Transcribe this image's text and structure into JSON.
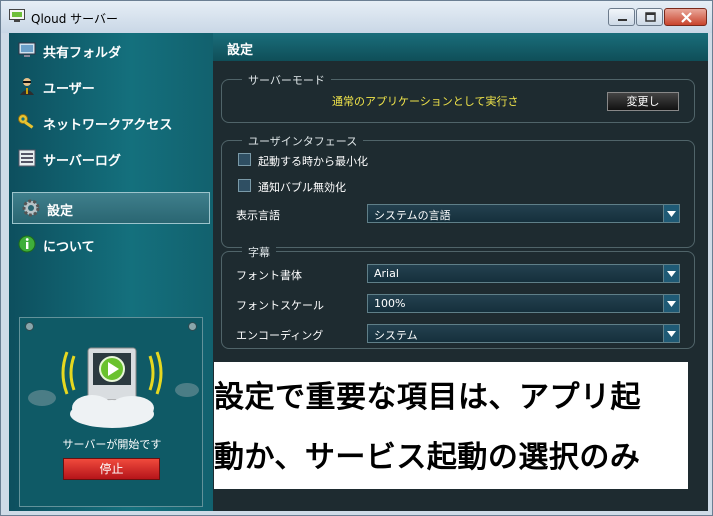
{
  "window": {
    "title": "Qloud サーバー"
  },
  "sidebar": {
    "items": [
      {
        "label": "共有フォルダ",
        "icon": "monitor-icon"
      },
      {
        "label": "ユーザー",
        "icon": "user-icon"
      },
      {
        "label": "ネットワークアクセス",
        "icon": "key-icon"
      },
      {
        "label": "サーバーログ",
        "icon": "log-icon"
      },
      {
        "label": "設定",
        "icon": "gear-icon",
        "active": true
      },
      {
        "label": "について",
        "icon": "info-icon"
      }
    ],
    "server": {
      "status": "サーバーが開始です",
      "stop_label": "停止"
    }
  },
  "main": {
    "title": "設定",
    "server_mode": {
      "title": "サーバーモード",
      "mode_text": "通常のアプリケーションとして実行さ",
      "change_label": "変更し"
    },
    "ui": {
      "title": "ユーザインタフェース",
      "minimize_label": "起動する時から最小化",
      "minimize_checked": false,
      "notify_label": "通知バブル無効化",
      "notify_checked": false,
      "language_label": "表示言語",
      "language_value": "システムの言語"
    },
    "subtitles": {
      "title": "字幕",
      "font_label": "フォント書体",
      "font_value": "Arial",
      "scale_label": "フォントスケール",
      "scale_value": "100%",
      "encoding_label": "エンコーディング",
      "encoding_value": "システム"
    }
  },
  "annotation": {
    "line1": "設定で重要な項目は、アプリ起",
    "line2": "動か、サービス起動の選択のみ"
  },
  "colors": {
    "accent": "#14707d",
    "mode_text": "#f0e44a",
    "stop_button": "#d42a2a"
  }
}
